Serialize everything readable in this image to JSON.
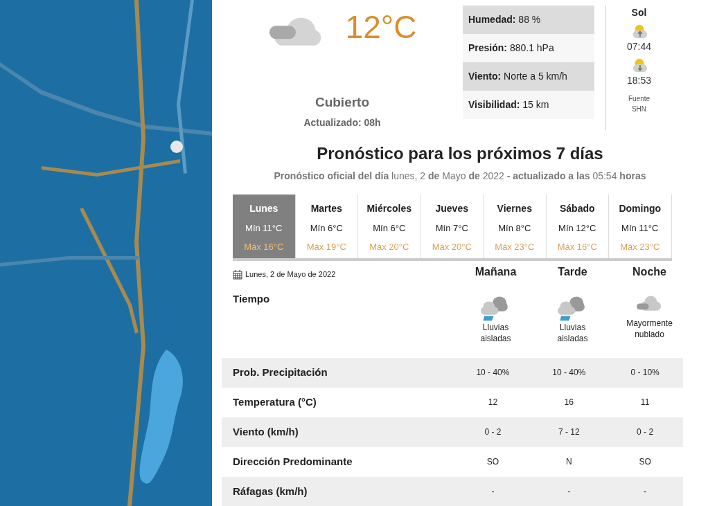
{
  "current": {
    "kind": "overcast",
    "temperature": "12°C",
    "condition": "Cubierto",
    "updated": "Actualizado: 08h"
  },
  "details": [
    {
      "label": "Humedad:",
      "value": "88 %"
    },
    {
      "label": "Presión:",
      "value": "880.1 hPa"
    },
    {
      "label": "Viento:",
      "value": "Norte a 5 km/h"
    },
    {
      "label": "Visibilidad:",
      "value": "15 km"
    }
  ],
  "sun": {
    "title": "Sol",
    "events": [
      {
        "kind": "sunrise",
        "time": "07:44"
      },
      {
        "kind": "sunset",
        "time": "18:53"
      }
    ],
    "source": "Fuente SHN"
  },
  "forecast": {
    "title": "Pronóstico para los próximos 7 días",
    "subtitle": "**Pronóstico oficial del día** lunes, 2 **de** Mayo **de** 2022 **- actualizado a las** 05:54 **horas**",
    "days": [
      {
        "name": "Lunes",
        "min": "Mín 11°C",
        "max": "Máx 16°C",
        "selected": true
      },
      {
        "name": "Martes",
        "min": "Mín 6°C",
        "max": "Máx 19°C",
        "selected": false
      },
      {
        "name": "Miércoles",
        "min": "Mín 6°C",
        "max": "Máx 20°C",
        "selected": false
      },
      {
        "name": "Jueves",
        "min": "Mín 7°C",
        "max": "Máx 20°C",
        "selected": false
      },
      {
        "name": "Viernes",
        "min": "Mín 8°C",
        "max": "Máx 23°C",
        "selected": false
      },
      {
        "name": "Sábado",
        "min": "Mín 12°C",
        "max": "Máx 16°C",
        "selected": false
      },
      {
        "name": "Domingo",
        "min": "Mín 11°C",
        "max": "Máx 23°C",
        "selected": false
      }
    ],
    "date": "Lunes, 2 de Mayo de 2022",
    "periods": [
      "Mañana",
      "Tarde",
      "Noche"
    ],
    "weather_label": "Tiempo",
    "weather": [
      {
        "kind": "rain",
        "text": "Lluvias aisladas"
      },
      {
        "kind": "rain",
        "text": "Lluvias aisladas"
      },
      {
        "kind": "cloudy",
        "text": "Mayormente nublado"
      }
    ],
    "rows": [
      {
        "label": "Prob. Precipitación",
        "values": [
          "10 - 40%",
          "10 - 40%",
          "0 - 10%"
        ]
      },
      {
        "label": "Temperatura (°C)",
        "values": [
          "12",
          "16",
          "11"
        ]
      },
      {
        "label": "Viento (km/h)",
        "values": [
          "0 - 2",
          "7 - 12",
          "0 - 2"
        ]
      },
      {
        "label": "Dirección Predominante",
        "values": [
          "SO",
          "N",
          "SO"
        ]
      },
      {
        "label": "Ráfagas (km/h)",
        "values": [
          "-",
          "-",
          "-"
        ]
      }
    ]
  }
}
